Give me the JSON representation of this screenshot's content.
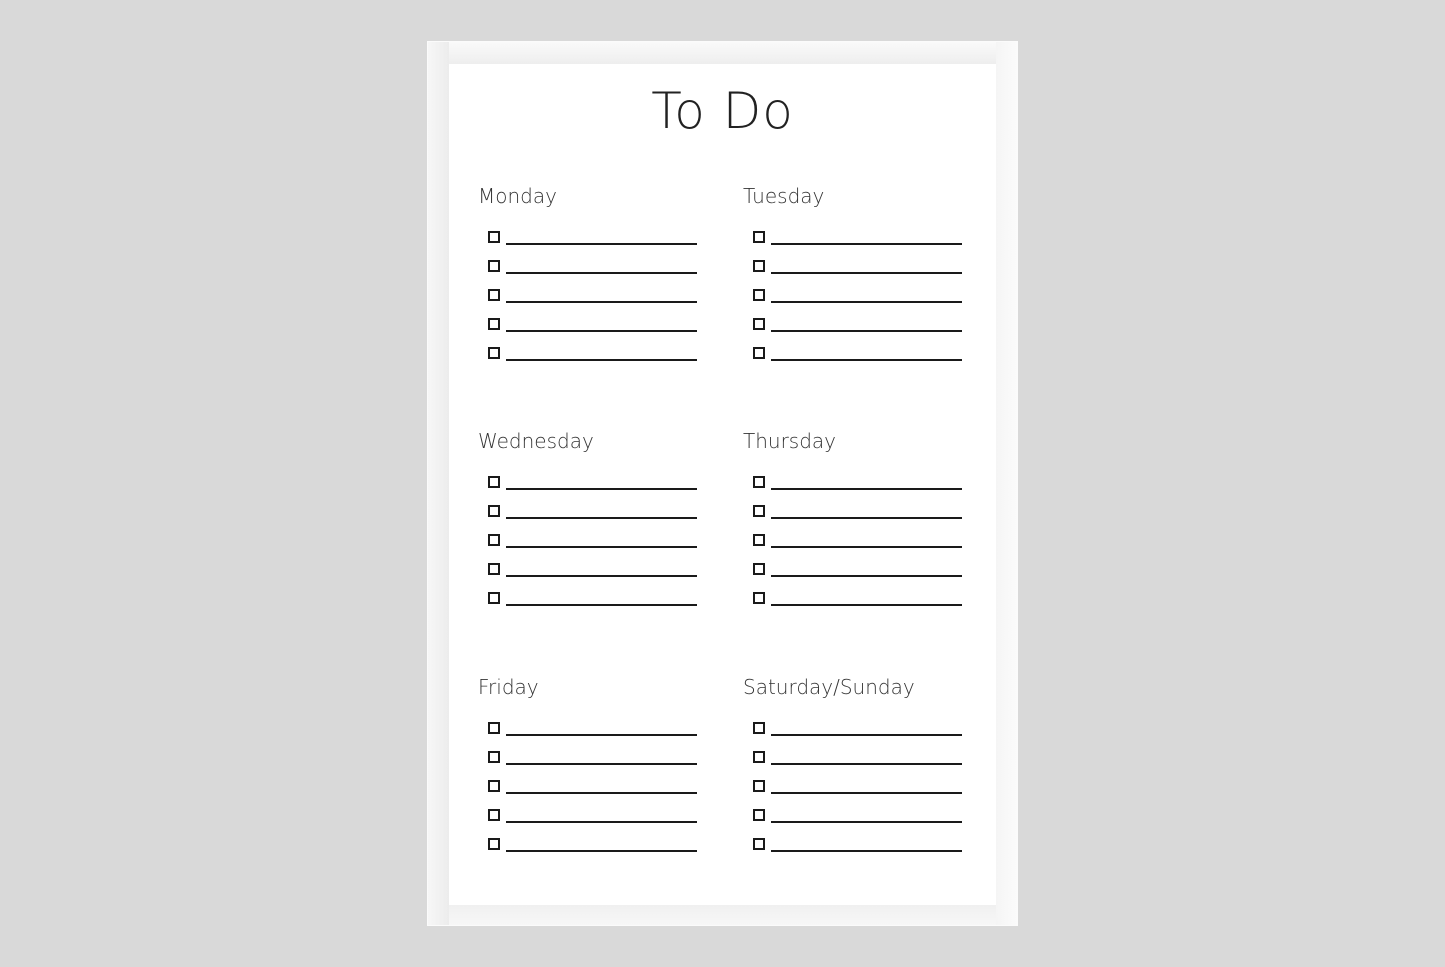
{
  "title": "To Do",
  "days": [
    {
      "label": "Monday",
      "items": 5
    },
    {
      "label": "Tuesday",
      "items": 5
    },
    {
      "label": "Wednesday",
      "items": 5
    },
    {
      "label": "Thursday",
      "items": 5
    },
    {
      "label": "Friday",
      "items": 5
    },
    {
      "label": "Saturday/Sunday",
      "items": 5
    }
  ]
}
